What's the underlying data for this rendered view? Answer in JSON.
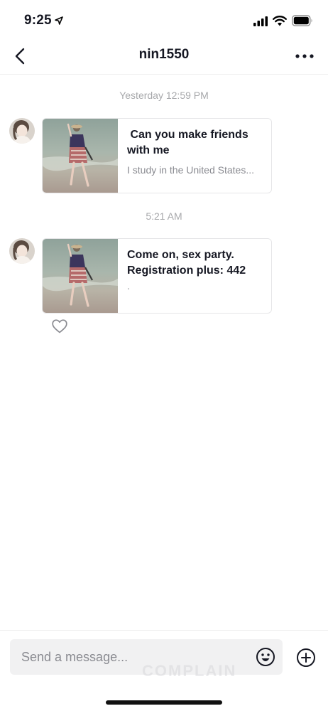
{
  "status_bar": {
    "time": "9:25",
    "icons": [
      "location-arrow-icon",
      "signal-icon",
      "wifi-icon",
      "battery-icon"
    ]
  },
  "header": {
    "title": "nin1550",
    "back_icon": "chevron-left-icon",
    "more_icon": "more-horizontal-icon"
  },
  "conversation": {
    "messages": [
      {
        "timestamp": "Yesterday 12:59 PM",
        "title": " Can you make friends with me",
        "subtitle": "I study in the United States...",
        "liked": false
      },
      {
        "timestamp": "5:21 AM",
        "title": "Come on, sex party. Registration plus: 442",
        "subtitle": ".",
        "liked": false
      }
    ]
  },
  "input": {
    "placeholder": "Send a message...",
    "value": "",
    "emoji_icon": "emoji-face-icon",
    "add_icon": "plus-circle-icon",
    "watermark": "COMPLAIN"
  },
  "colors": {
    "text_primary": "#161823",
    "text_secondary": "#8a8b91",
    "timestamp": "#a7a8ab",
    "input_bg": "#f1f1f2",
    "divider": "#efefef"
  }
}
